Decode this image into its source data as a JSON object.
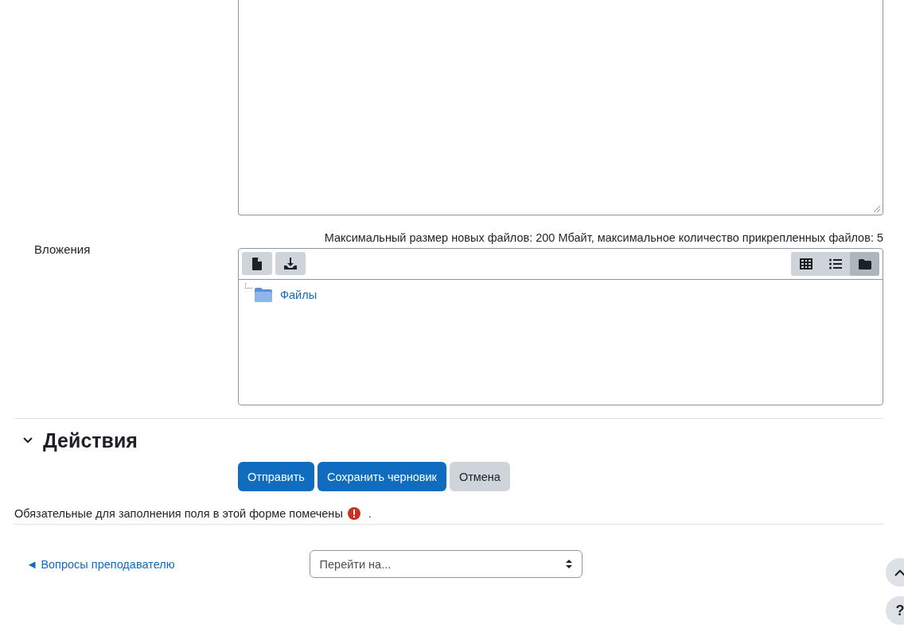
{
  "attachments": {
    "label": "Вложения",
    "limits": "Максимальный размер новых файлов: 200 Мбайт, максимальное количество прикрепленных файлов: 5",
    "view_modes": [
      {
        "kind": "icons",
        "selected": false
      },
      {
        "kind": "list",
        "selected": false
      },
      {
        "kind": "tree",
        "selected": true
      }
    ],
    "tree": [
      {
        "label": "Файлы"
      }
    ]
  },
  "actions_section": {
    "title": "Действия",
    "expanded": true
  },
  "buttons": [
    {
      "label": "Отправить",
      "kind": "primary"
    },
    {
      "label": "Сохранить черновик",
      "kind": "primary"
    },
    {
      "label": "Отмена",
      "kind": "secondary"
    }
  ],
  "required_note": {
    "text": "Обязательные для заполнения поля в этой форме помечены",
    "after": "."
  },
  "footer": {
    "prev_link": "◄ Вопросы преподавателю",
    "jump_placeholder": "Перейти на..."
  },
  "floating": {
    "help": "?"
  }
}
